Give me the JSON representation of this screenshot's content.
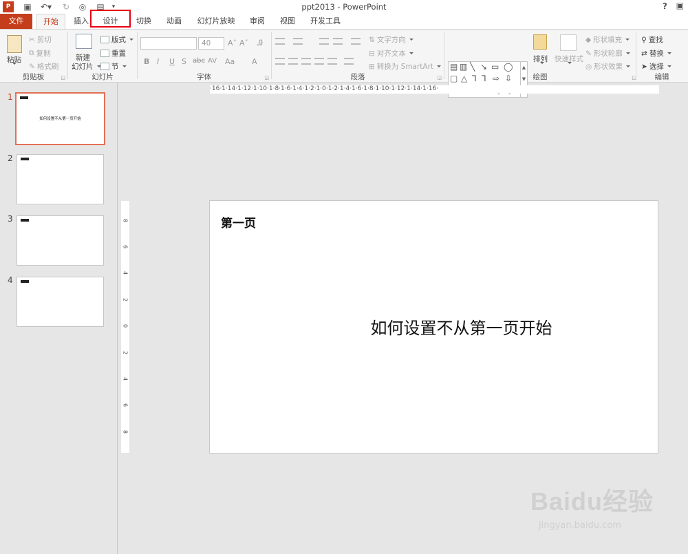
{
  "app": {
    "window_title": "ppt2013 - PowerPoint",
    "help": "?"
  },
  "tabs": [
    {
      "label": "文件"
    },
    {
      "label": "开始"
    },
    {
      "label": "插入"
    },
    {
      "label": "设计"
    },
    {
      "label": "切换"
    },
    {
      "label": "动画"
    },
    {
      "label": "幻灯片放映"
    },
    {
      "label": "审阅"
    },
    {
      "label": "视图"
    },
    {
      "label": "开发工具"
    }
  ],
  "ribbon": {
    "clipboard": {
      "label": "剪贴板",
      "paste": "粘贴",
      "cut": "剪切",
      "copy": "复制",
      "format_painter": "格式刷"
    },
    "slides": {
      "label": "幻灯片",
      "new_slide_1": "新建",
      "new_slide_2": "幻灯片",
      "layout": "版式",
      "reset": "重置",
      "section": "节"
    },
    "font": {
      "label": "字体",
      "font_size": "40",
      "bold": "B",
      "italic": "I",
      "underline": "U",
      "shadow": "S",
      "strike": "abc",
      "spacing": "AV",
      "case": "Aa",
      "color": "A"
    },
    "paragraph": {
      "label": "段落",
      "text_direction": "文字方向",
      "align_text": "对齐文本",
      "smartart": "转换为 SmartArt"
    },
    "drawing": {
      "label": "绘图",
      "arrange": "排列",
      "quick_styles": "快速样式",
      "shape_fill": "形状填充",
      "shape_outline": "形状轮廓",
      "shape_effects": "形状效果"
    },
    "editing": {
      "label": "编辑",
      "find": "查找",
      "replace": "替换",
      "select": "选择"
    }
  },
  "thumbnails": [
    {
      "num": "1",
      "subtitle": "如何设置不从第一页开始"
    },
    {
      "num": "2"
    },
    {
      "num": "3"
    },
    {
      "num": "4"
    }
  ],
  "ruler": {
    "labels": "·16·1·14·1·12·1·10·1·8·1·6·1·4·1·2·1·0·1·2·1·4·1·6·1·8·1·10·1·12·1·14·1·16·"
  },
  "vruler": {
    "labels": [
      "8",
      "6",
      "4",
      "2",
      "0",
      "2",
      "4",
      "6",
      "8"
    ]
  },
  "slide": {
    "title": "第一页",
    "subtitle": "如何设置不从第一页开始"
  },
  "watermark": {
    "logo": "Baidu经验",
    "url": "jingyan.baidu.com"
  },
  "colors": {
    "file_tab": "#c43e1c",
    "highlight_box": "#e60012",
    "selected_thumb": "#e37055"
  }
}
